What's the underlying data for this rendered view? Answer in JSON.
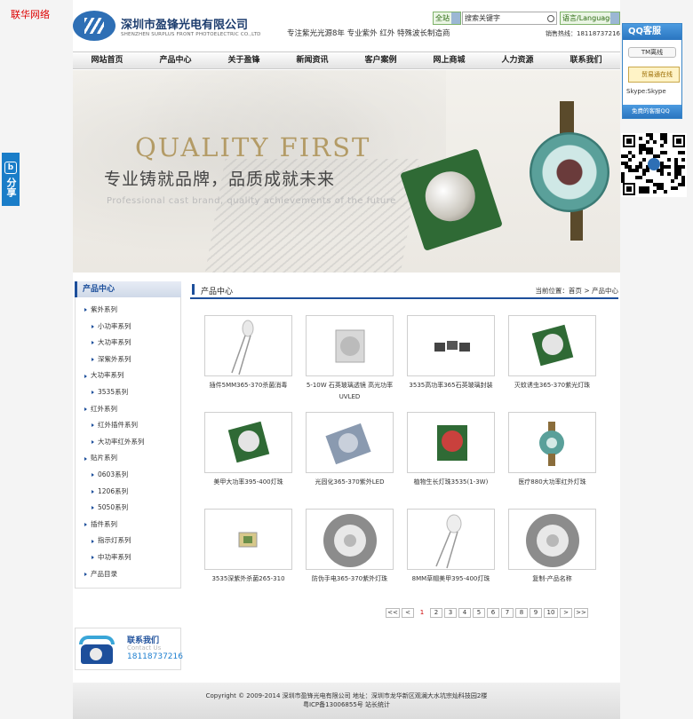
{
  "page": {
    "corner_brand": "联华网络"
  },
  "share": {
    "label": "分享",
    "icon_letter": "b"
  },
  "header": {
    "company_cn": "深圳市盈锋光电有限公司",
    "company_en": "SHENZHEN SURPLUS FRONT PHOTOELECTRIC CO.,LTD",
    "slogan": "专注紫光光源8年 专业紫外 红外 特殊波长制造商",
    "scope_select": "全站",
    "search_placeholder": "搜索关键字",
    "lang_select": "语言/Language",
    "hotline": "销售热线：18118737216"
  },
  "nav": {
    "items": [
      "网站首页",
      "产品中心",
      "关于盈锋",
      "新闻资讯",
      "客户案例",
      "网上商城",
      "人力资源",
      "联系我们"
    ]
  },
  "banner": {
    "title": "QUALITY FIRST",
    "subtitle": "专业铸就品牌，品质成就未来",
    "english": "Professional cast brand, quality achievements of the future"
  },
  "sidebar": {
    "heading": "产品中心",
    "items": [
      {
        "label": "紫外系列",
        "level": 1
      },
      {
        "label": "小功率系列",
        "level": 2
      },
      {
        "label": "大功率系列",
        "level": 2
      },
      {
        "label": "深紫外系列",
        "level": 2
      },
      {
        "label": "大功率系列",
        "level": 1
      },
      {
        "label": "3535系列",
        "level": 2
      },
      {
        "label": "红外系列",
        "level": 1
      },
      {
        "label": "红外插件系列",
        "level": 2
      },
      {
        "label": "大功率红外系列",
        "level": 2
      },
      {
        "label": "贴片系列",
        "level": 1
      },
      {
        "label": "0603系列",
        "level": 2
      },
      {
        "label": "1206系列",
        "level": 2
      },
      {
        "label": "5050系列",
        "level": 2
      },
      {
        "label": "插件系列",
        "level": 1
      },
      {
        "label": "指示灯系列",
        "level": 2
      },
      {
        "label": "中功率系列",
        "level": 2
      },
      {
        "label": "产品目录",
        "level": 1
      }
    ]
  },
  "contact": {
    "title": "联系我们",
    "english": "Contact Us",
    "phone": "18118737216"
  },
  "content": {
    "title": "产品中心",
    "breadcrumb": "当前位置：首页 > 产品中心",
    "products": [
      {
        "caption": "插件5MM365-370杀菌消毒",
        "icon": "through-hole-led"
      },
      {
        "caption": "5-10W 石英玻璃透镜 高光功率UVLED",
        "icon": "cob-uv-led"
      },
      {
        "caption": "3535高功率365石英玻璃封装",
        "icon": "smd-3535"
      },
      {
        "caption": "灭蚊诱虫365-370紫光灯珠",
        "icon": "high-power-uv"
      },
      {
        "caption": "美甲大功率395-400灯珠",
        "icon": "high-power-uv"
      },
      {
        "caption": "光固化365-370紫外LED",
        "icon": "uv-module"
      },
      {
        "caption": "植物生长灯珠3535(1-3W)",
        "icon": "smd-3535-red"
      },
      {
        "caption": "医疗880大功率红外灯珠",
        "icon": "ir-star-led"
      },
      {
        "caption": "3535深紫外杀菌265-310",
        "icon": "deep-uv-chip"
      },
      {
        "caption": "防伪手电365-370紫外灯珠",
        "icon": "star-led"
      },
      {
        "caption": "8MM草帽美甲395-400灯珠",
        "icon": "strawhat-led"
      },
      {
        "caption": "复制-产品名称",
        "icon": "star-led"
      }
    ]
  },
  "pager": {
    "first": "<<",
    "prev": "<",
    "pages": [
      "1",
      "2",
      "3",
      "4",
      "5",
      "6",
      "7",
      "8",
      "9",
      "10"
    ],
    "current": "1",
    "next": ">",
    "last": ">>"
  },
  "footer": {
    "line1": "Copyright © 2009-2014 深圳市盈锋光电有限公司 地址：深圳市龙华新区观澜大水坑宗灿科技园2楼",
    "line2": "粤ICP备13006855号   站长统计"
  },
  "qq_panel": {
    "title": "QQ客服",
    "tm_label": "TM离线",
    "ali_label": "贸易通在线",
    "skype_label": "Skype:Skype",
    "footer": "免费的客服QQ"
  }
}
